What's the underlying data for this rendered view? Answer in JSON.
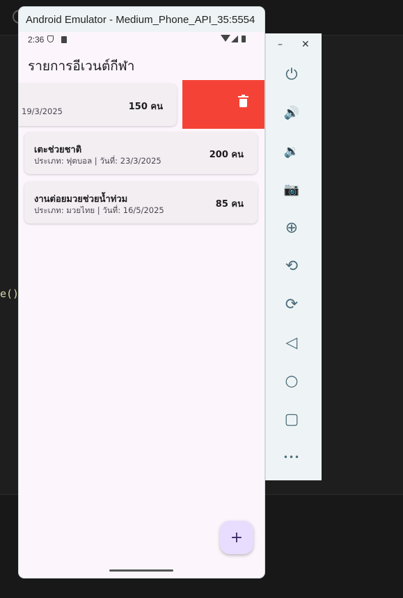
{
  "window": {
    "title": "Android Emulator - Medium_Phone_API_35:5554"
  },
  "status_bar": {
    "time": "2:36"
  },
  "app": {
    "title": "รายการอีเวนต์กีฬา"
  },
  "events": [
    {
      "name": "",
      "meta": "19/3/2025",
      "count": "150 คน"
    },
    {
      "name": "เตะช่วยชาติ",
      "meta": "ประเภท: ฟุตบอล | วันที่: 23/3/2025",
      "count": "200 คน"
    },
    {
      "name": "งานต่อยมวยช่วยน้ำท่วม",
      "meta": "ประเภท: มวยไทย | วันที่: 16/5/2025",
      "count": "85 คน"
    }
  ],
  "fab": {
    "label": "+"
  },
  "toolbar": {
    "minimize": "–",
    "close": "✕",
    "buttons": [
      {
        "icon": "power-icon",
        "glyph": "⏻"
      },
      {
        "icon": "volume-up-icon",
        "glyph": "🔊"
      },
      {
        "icon": "volume-down-icon",
        "glyph": "🔉"
      },
      {
        "icon": "camera-icon",
        "glyph": "📷"
      },
      {
        "icon": "zoom-icon",
        "glyph": "⊕"
      },
      {
        "icon": "rotate-left-icon",
        "glyph": "⟲"
      },
      {
        "icon": "rotate-right-icon",
        "glyph": "⟳"
      },
      {
        "icon": "back-icon",
        "glyph": "◁"
      },
      {
        "icon": "home-icon",
        "glyph": "○"
      },
      {
        "icon": "overview-icon",
        "glyph": "▢"
      },
      {
        "icon": "more-icon",
        "glyph": "•••"
      }
    ]
  },
  "ide": {
    "code_snippet": "e()"
  },
  "colors": {
    "delete": "#f44336",
    "fab": "#e8ddff",
    "background": "#fcf6fc"
  }
}
